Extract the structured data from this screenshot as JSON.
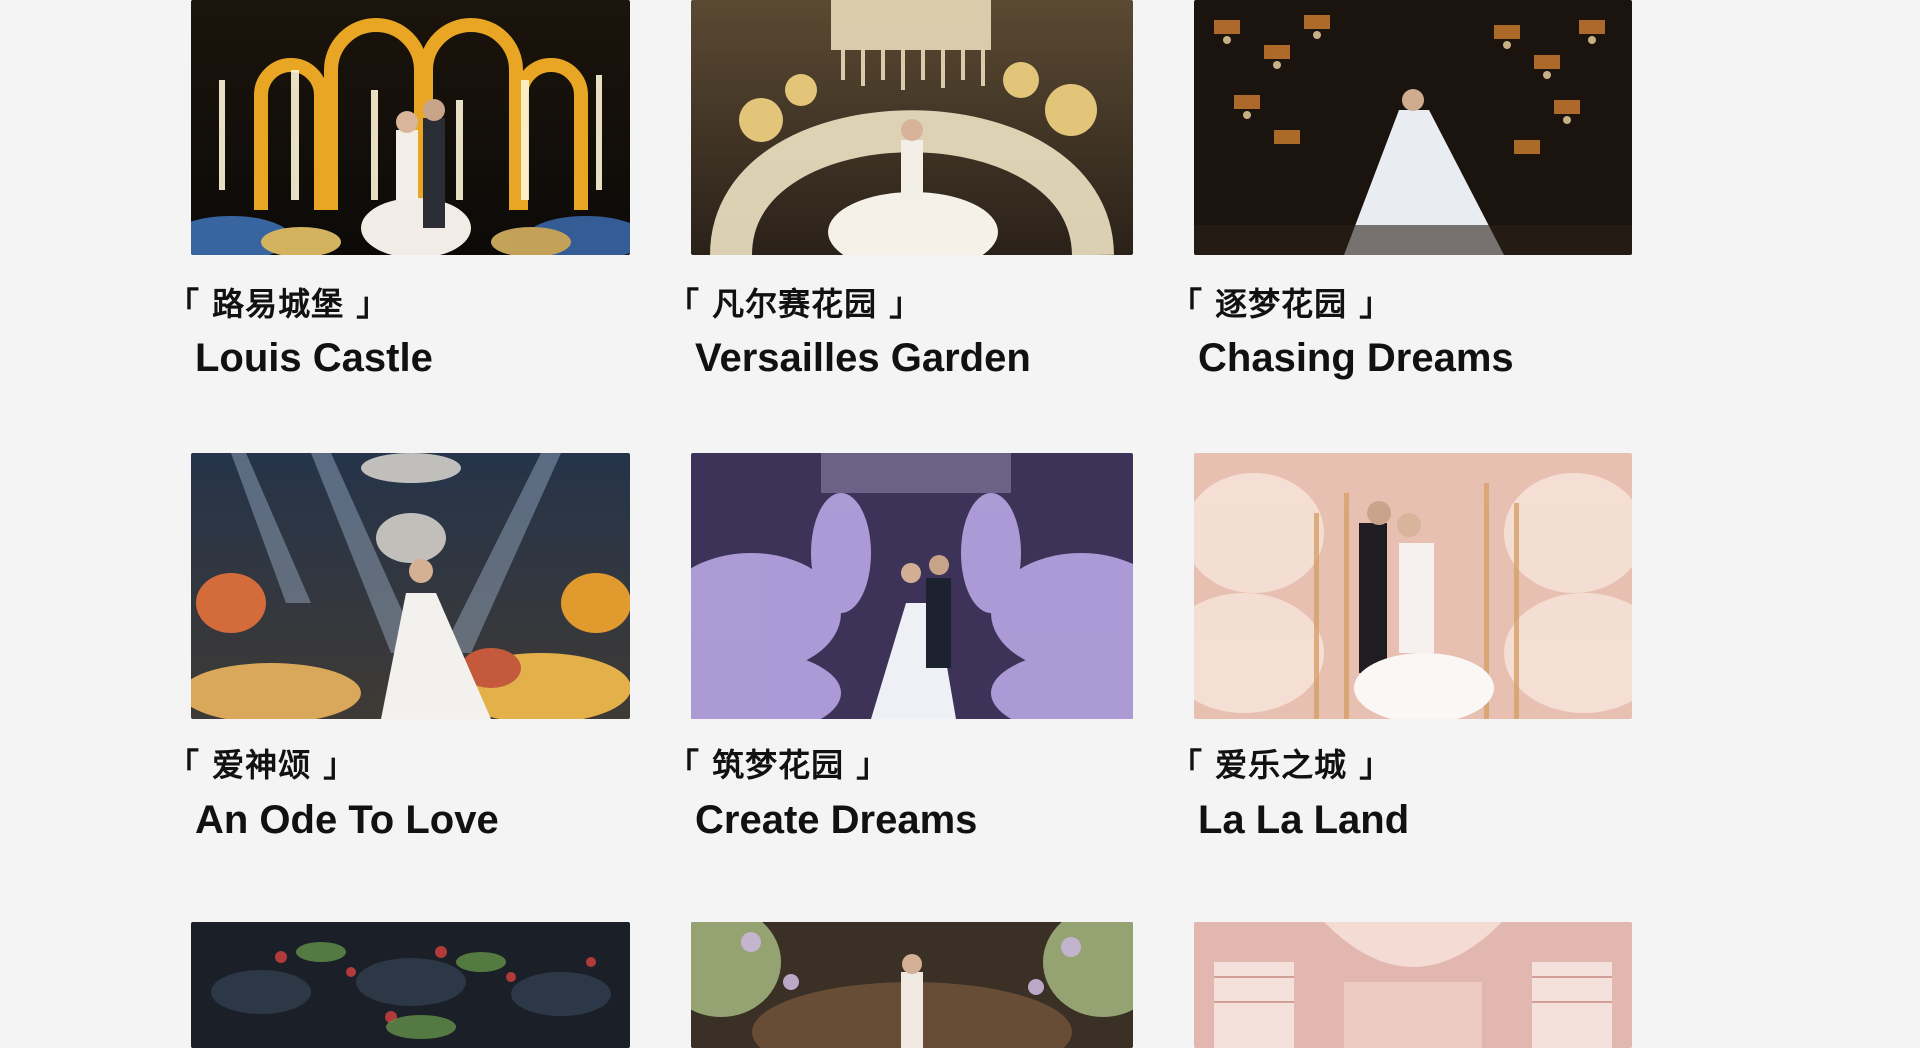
{
  "gallery": {
    "items": [
      {
        "title_cn": "「 路易城堡 」",
        "title_en": "Louis Castle",
        "scene": "golden arches with sparkler fountains, couple kissing on stage"
      },
      {
        "title_cn": "「 凡尔赛花园 」",
        "title_en": "Versailles Garden",
        "scene": "bride under crystal chandelier framed by cream floral arch"
      },
      {
        "title_cn": "「 逐梦花园 」",
        "title_en": "Chasing Dreams",
        "scene": "bride in long gown among hanging crystal chandeliers"
      },
      {
        "title_cn": "「 爱神颂 」",
        "title_en": "An Ode To Love",
        "scene": "bride in hall with spotlight beams and colorful floral tables"
      },
      {
        "title_cn": "「 筑梦花园 」",
        "title_en": "Create Dreams",
        "scene": "couple on aisle surrounded by lavender florals"
      },
      {
        "title_cn": "「 爱乐之城 」",
        "title_en": "La La Land",
        "scene": "couple kissing among pink floral columns"
      },
      {
        "title_cn": "",
        "title_en": "",
        "scene": "dark banquet hall with red and green florals"
      },
      {
        "title_cn": "",
        "title_en": "",
        "scene": "bride under floral arch on dark stage"
      },
      {
        "title_cn": "",
        "title_en": "",
        "scene": "pink hall with drapery and balconies"
      }
    ]
  },
  "colors": {
    "background": "#f4f4f4",
    "text": "#111111"
  }
}
